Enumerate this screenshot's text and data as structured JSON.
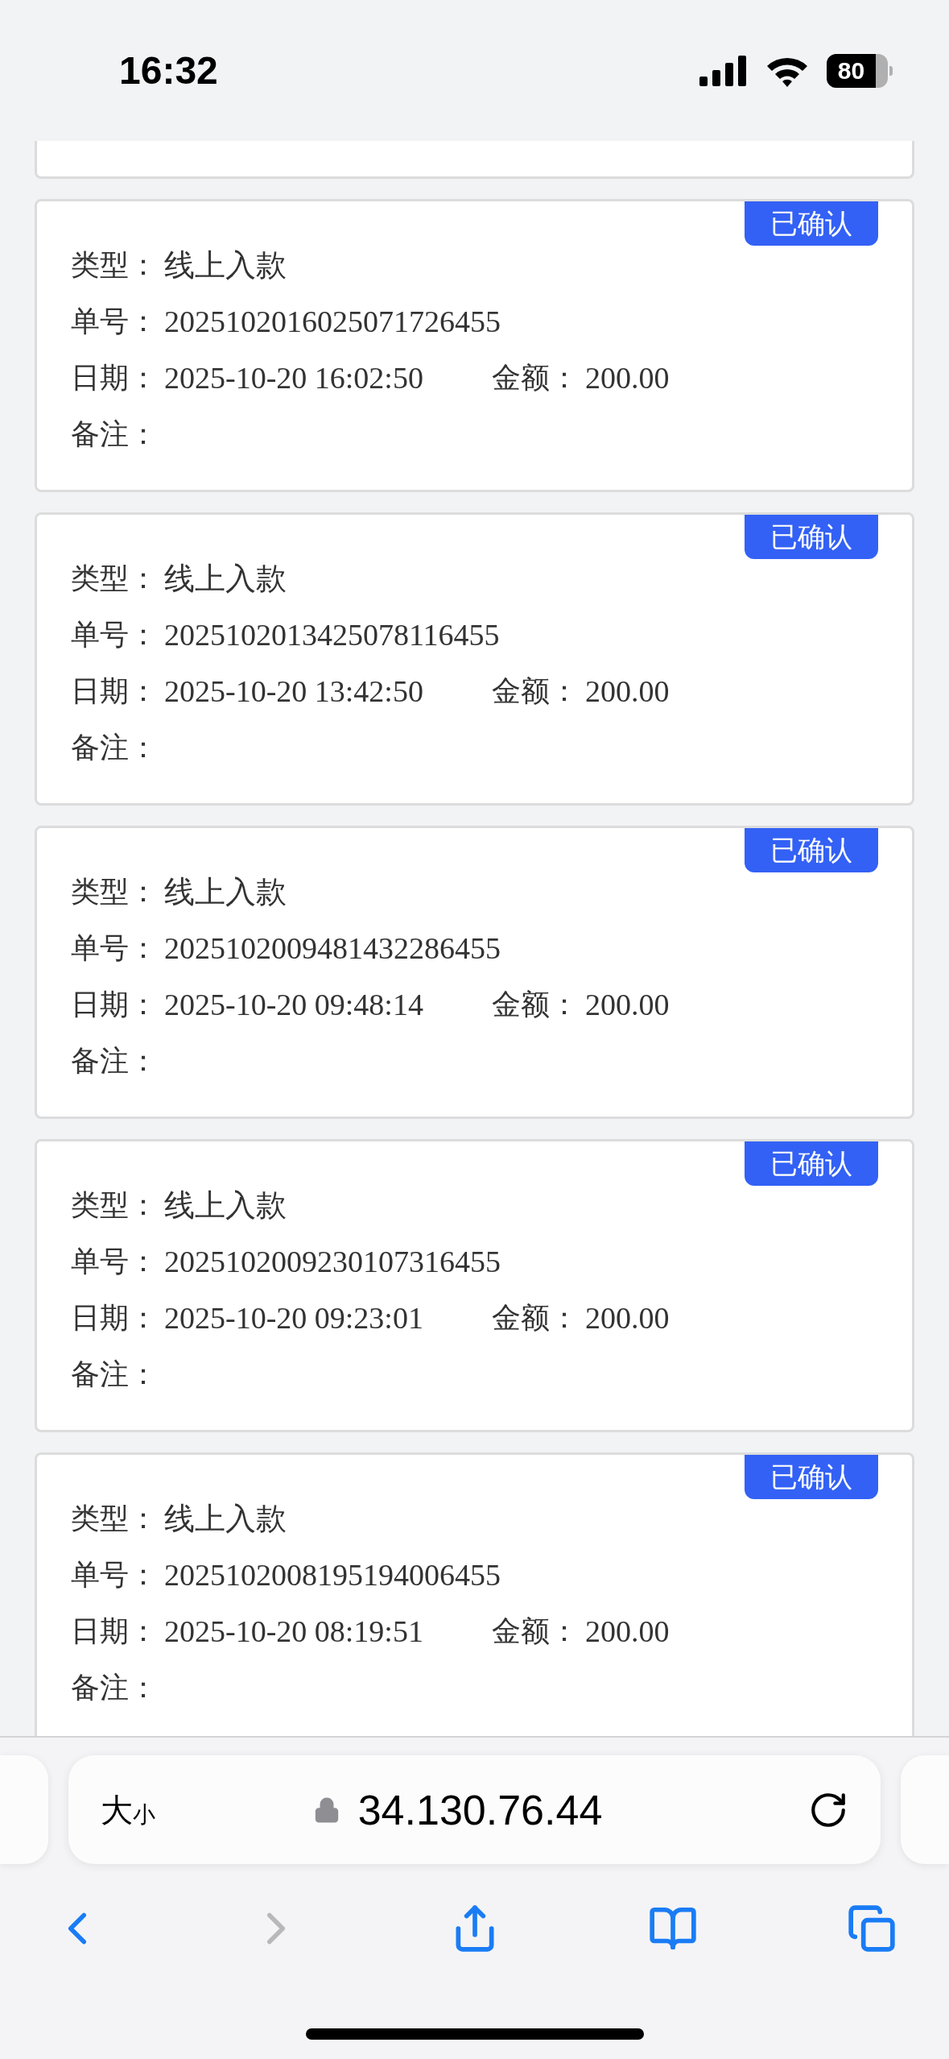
{
  "status_bar": {
    "time": "16:32",
    "battery": "80"
  },
  "records": [
    {
      "badge": {
        "text": "已确认",
        "confirmed": true
      },
      "type": {
        "label": "类型：",
        "value": "线上入款"
      },
      "order_no": {
        "label": "单号：",
        "value": "2025102016025071726455"
      },
      "date": {
        "label": "日期：",
        "value": "2025-10-20 16:02:50"
      },
      "amount": {
        "label": "金额：",
        "value": "200.00"
      },
      "note": {
        "label": "备注："
      }
    },
    {
      "badge": {
        "text": "已确认",
        "confirmed": true
      },
      "type": {
        "label": "类型：",
        "value": "线上入款"
      },
      "order_no": {
        "label": "单号：",
        "value": "2025102013425078116455"
      },
      "date": {
        "label": "日期：",
        "value": "2025-10-20 13:42:50"
      },
      "amount": {
        "label": "金额：",
        "value": "200.00"
      },
      "note": {
        "label": "备注："
      }
    },
    {
      "badge": {
        "text": "已确认",
        "confirmed": true
      },
      "type": {
        "label": "类型：",
        "value": "线上入款"
      },
      "order_no": {
        "label": "单号：",
        "value": "2025102009481432286455"
      },
      "date": {
        "label": "日期：",
        "value": "2025-10-20 09:48:14"
      },
      "amount": {
        "label": "金额：",
        "value": "200.00"
      },
      "note": {
        "label": "备注："
      }
    },
    {
      "badge": {
        "text": "已确认",
        "confirmed": true
      },
      "type": {
        "label": "类型：",
        "value": "线上入款"
      },
      "order_no": {
        "label": "单号：",
        "value": "2025102009230107316455"
      },
      "date": {
        "label": "日期：",
        "value": "2025-10-20 09:23:01"
      },
      "amount": {
        "label": "金额：",
        "value": "200.00"
      },
      "note": {
        "label": "备注："
      }
    },
    {
      "badge": {
        "text": "已确认",
        "confirmed": true
      },
      "type": {
        "label": "类型：",
        "value": "线上入款"
      },
      "order_no": {
        "label": "单号：",
        "value": "2025102008195194006455"
      },
      "date": {
        "label": "日期：",
        "value": "2025-10-20 08:19:51"
      },
      "amount": {
        "label": "金额：",
        "value": "200.00"
      },
      "note": {
        "label": "备注："
      }
    }
  ],
  "browser": {
    "text_size": {
      "large": "大",
      "small": "小"
    },
    "url": "34.130.76.44",
    "secure": true,
    "nav": [
      {
        "kind": "back",
        "disabled": false
      },
      {
        "kind": "forward",
        "disabled": true
      },
      {
        "kind": "share",
        "disabled": false
      },
      {
        "kind": "bookmarks",
        "disabled": false
      },
      {
        "kind": "tabs",
        "disabled": false
      }
    ]
  }
}
